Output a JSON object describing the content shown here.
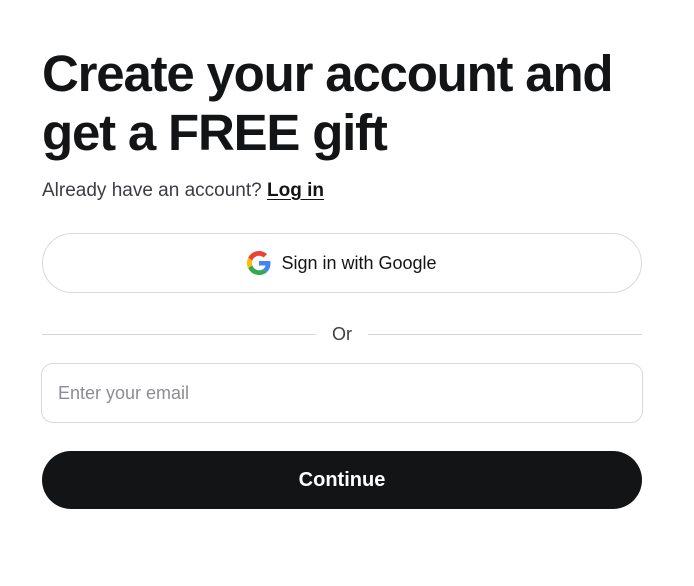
{
  "header": {
    "title_line1": "Create your account and",
    "title_line2": "get a FREE gift"
  },
  "login": {
    "prompt": "Already have an account?",
    "link_label": "Log in"
  },
  "google": {
    "label": "Sign in with Google",
    "icon": "google-icon"
  },
  "divider": {
    "label": "Or"
  },
  "email": {
    "placeholder": "Enter your email",
    "value": ""
  },
  "continue": {
    "label": "Continue"
  },
  "colors": {
    "primary": "#131416",
    "border": "#d8d9dc",
    "placeholder": "#8b8d93",
    "google_blue": "#4285F4",
    "google_red": "#EA4335",
    "google_yellow": "#FBBC05",
    "google_green": "#34A853"
  }
}
